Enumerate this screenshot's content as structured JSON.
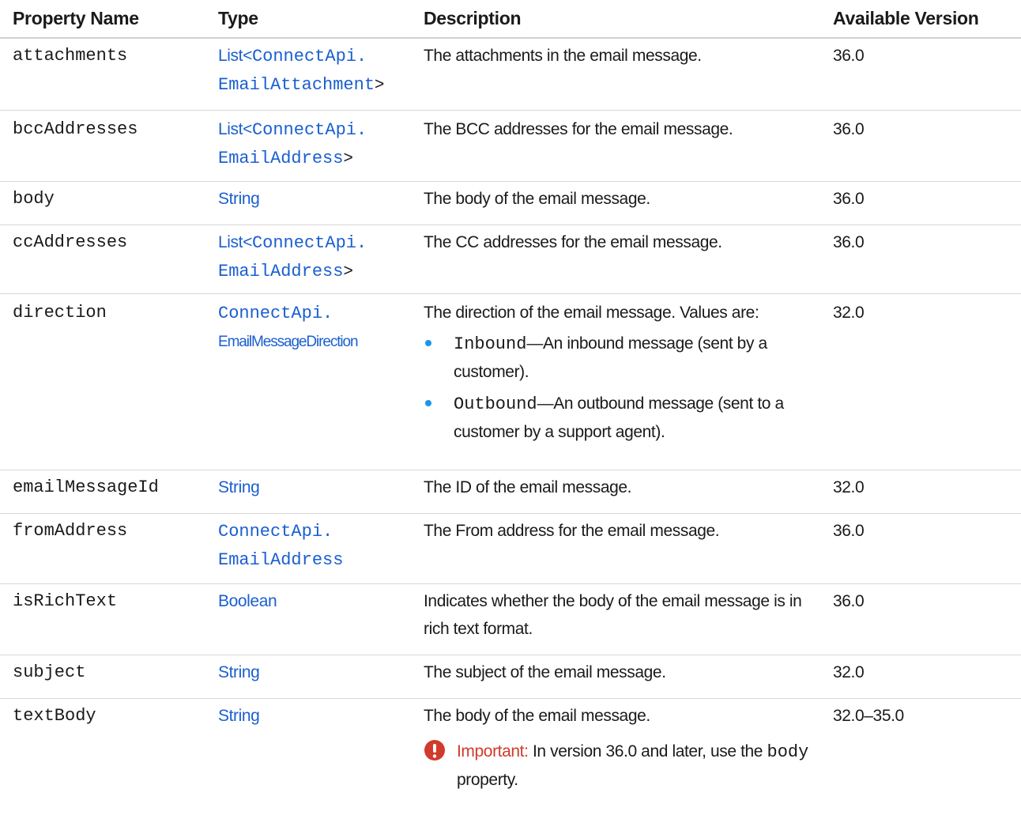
{
  "columns": [
    "Property Name",
    "Type",
    "Description",
    "Available Version"
  ],
  "rows": [
    {
      "prop": "attachments",
      "type_pre": "List<",
      "type_link1": "ConnectApi.",
      "type_link2": "EmailAttachment",
      "type_post": ">",
      "desc": "The attachments in the email message.",
      "version": "36.0"
    },
    {
      "prop": "bccAddresses",
      "type_pre": "List<",
      "type_link1": "ConnectApi.",
      "type_link2": "EmailAddress",
      "type_post": ">",
      "desc": "The BCC addresses for the email message.",
      "version": "36.0"
    },
    {
      "prop": "body",
      "type": "String",
      "desc": "The body of the email message.",
      "version": "36.0"
    },
    {
      "prop": "ccAddresses",
      "type_pre": "List<",
      "type_link1": "ConnectApi.",
      "type_link2": "EmailAddress",
      "type_post": ">",
      "desc": "The CC addresses for the email message.",
      "version": "36.0"
    },
    {
      "prop": "direction",
      "type_link1": "ConnectApi.",
      "type_link2": "EmailMessageDirection",
      "desc": "The direction of the email message. Values are:",
      "bullets": [
        {
          "code": "Inbound",
          "text": "—An inbound message (sent by a customer)."
        },
        {
          "code": "Outbound",
          "text": "—An outbound message (sent to a customer by a support agent)."
        }
      ],
      "version": "32.0"
    },
    {
      "prop": "emailMessageId",
      "type": "String",
      "desc": "The ID of the email message.",
      "version": "32.0"
    },
    {
      "prop": "fromAddress",
      "type_link1": "ConnectApi.",
      "type_link2": "EmailAddress",
      "desc": "The From address for the email message.",
      "version": "36.0"
    },
    {
      "prop": "isRichText",
      "type": "Boolean",
      "desc": "Indicates whether the body of the email message is in rich text format.",
      "version": "36.0"
    },
    {
      "prop": "subject",
      "type": "String",
      "desc": "The subject of the email message.",
      "version": "32.0"
    },
    {
      "prop": "textBody",
      "type": "String",
      "desc": "The body of the email message.",
      "important": {
        "label": "Important:",
        "text_pre": " In version 36.0 and later, use the ",
        "code": "body",
        "text_post": " property."
      },
      "version": "32.0–35.0"
    }
  ],
  "colors": {
    "link": "#1a5fd1",
    "bullet": "#1b96e8",
    "important": "#d13a2c"
  },
  "icons": {
    "important": "exclamation-circle-icon"
  }
}
